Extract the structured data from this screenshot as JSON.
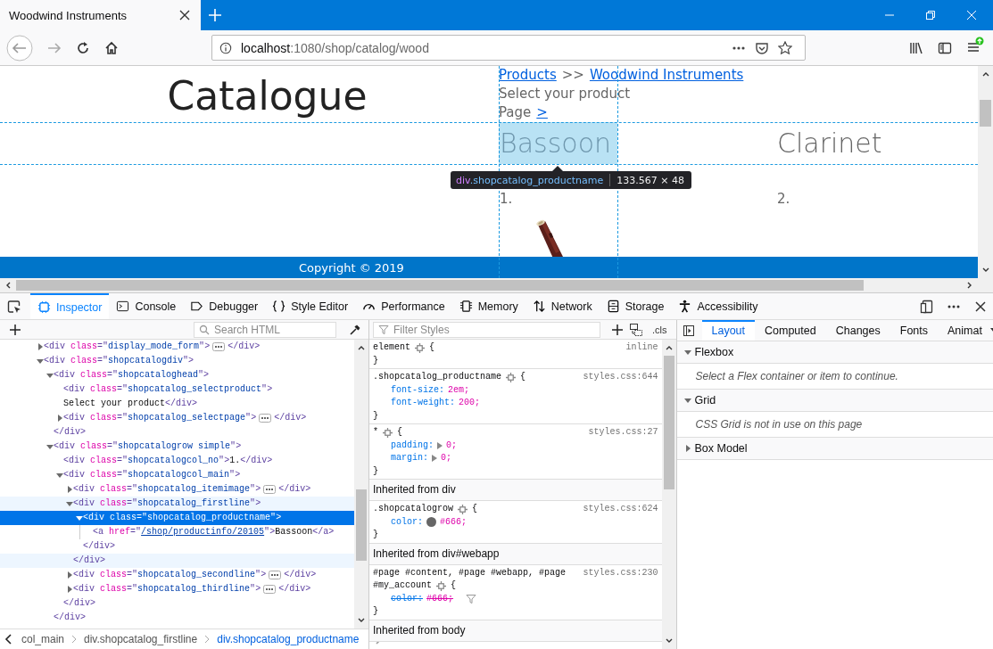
{
  "browser": {
    "tabs": [
      {
        "title": "Woodwind Instruments",
        "selected": true
      }
    ],
    "url_host": "localhost",
    "url_path": ":1080/shop/catalog/wood",
    "update_available": true
  },
  "page": {
    "heading": "Catalogue",
    "breadcrumb": [
      {
        "text": "Products",
        "link": true
      },
      {
        "text": ">>",
        "link": false
      },
      {
        "text": "Woodwind Instruments",
        "link": true
      }
    ],
    "select_label": "Select your product",
    "page_label": "Page",
    "page_link": ">",
    "products": [
      {
        "name": "Bassoon",
        "number": "1.",
        "highlighted": true
      },
      {
        "name": "Clarinet",
        "number": "2.",
        "highlighted": false
      }
    ],
    "footer": "Copyright © 2019"
  },
  "highlighter": {
    "tag": "div",
    "class_name": ".shopcatalog_productname",
    "size": "133.567 × 48"
  },
  "devtools": {
    "tools": [
      {
        "label": "Inspector",
        "kind": "inspector",
        "selected": true
      },
      {
        "label": "Console",
        "kind": "console",
        "selected": false
      },
      {
        "label": "Debugger",
        "kind": "debugger",
        "selected": false
      },
      {
        "label": "Style Editor",
        "kind": "style-editor",
        "selected": false
      },
      {
        "label": "Performance",
        "kind": "performance",
        "selected": false
      },
      {
        "label": "Memory",
        "kind": "memory",
        "selected": false
      },
      {
        "label": "Network",
        "kind": "network",
        "selected": false
      },
      {
        "label": "Storage",
        "kind": "storage",
        "selected": false
      },
      {
        "label": "Accessibility",
        "kind": "accessibility",
        "selected": false
      }
    ],
    "html_search": {
      "placeholder": "Search HTML"
    },
    "tree": [
      {
        "open_tag": "<div class=\"display_mode_form\">",
        "close_tag": "</div>",
        "expanded": false,
        "selected": false,
        "hovered": false
      },
      {
        "open_tag": "<div class=\"shopcatalogdiv\">",
        "expanded": true,
        "selected": false,
        "hovered": false,
        "children": [
          {
            "open_tag": "<div class=\"shopcataloghead\">",
            "close_tag": "</div>",
            "expanded": true,
            "selected": false,
            "hovered": false,
            "children": [
              {
                "open_tag": "<div class=\"shopcatalog_selectproduct\">",
                "text": "Select your product",
                "close_tag": "</div>",
                "selected": false,
                "hovered": false
              },
              {
                "open_tag": "<div class=\"shopcatalog_selectpage\">",
                "close_tag": "</div>",
                "expanded": false,
                "selected": false,
                "hovered": false
              }
            ]
          },
          {
            "open_tag": "<div class=\"shopcatalogrow simple\">",
            "close_tag": "</div>",
            "expanded": true,
            "selected": false,
            "hovered": false,
            "children": [
              {
                "open_tag": "<div class=\"shopcatalogcol_no\">",
                "text": "1.",
                "close_tag": "</div>",
                "selected": false,
                "hovered": false
              },
              {
                "open_tag": "<div class=\"shopcatalogcol_main\">",
                "close_tag": "</div>",
                "expanded": true,
                "selected": false,
                "hovered": false,
                "children": [
                  {
                    "open_tag": "<div class=\"shopcatalog_itemimage\">",
                    "close_tag": "</div>",
                    "expanded": false,
                    "selected": false,
                    "hovered": false
                  },
                  {
                    "open_tag": "<div class=\"shopcatalog_firstline\">",
                    "close_tag": "</div>",
                    "expanded": true,
                    "selected": false,
                    "hovered": true,
                    "children": [
                      {
                        "open_tag": "<div class=\"shopcatalog_productname\">",
                        "close_tag": "</div>",
                        "expanded": true,
                        "selected": true,
                        "hovered": false,
                        "children": [
                          {
                            "open_tag": "<a href=\"/shop/productinfo/20105\">",
                            "text": "Bassoon",
                            "close_tag": "</a>",
                            "link_values": true,
                            "selected": false,
                            "hovered": false
                          }
                        ]
                      }
                    ]
                  },
                  {
                    "open_tag": "<div class=\"shopcatalog_secondline\">",
                    "close_tag": "</div>",
                    "expanded": false,
                    "selected": false,
                    "hovered": false
                  },
                  {
                    "open_tag": "<div class=\"shopcatalog_thirdline\">",
                    "close_tag": "</div>",
                    "expanded": false,
                    "selected": false,
                    "hovered": false
                  }
                ]
              }
            ]
          }
        ]
      }
    ],
    "breadcrumbs": [
      {
        "label": "col_main",
        "selected": false
      },
      {
        "label": "div.shopcatalog_firstline",
        "selected": false
      },
      {
        "label": "div.shopcatalog_productname",
        "selected": true
      }
    ],
    "styles_filter": {
      "placeholder": "Filter Styles"
    },
    "cls_label": ".cls",
    "rules": [
      {
        "kind": "rule",
        "selector": [
          "element"
        ],
        "open_brace": "{",
        "close_brace": "}",
        "source": "inline"
      },
      {
        "kind": "rule",
        "selector": [
          ".shopcatalog_productname"
        ],
        "open_brace": "{",
        "close_brace": "}",
        "source": "styles.css:644",
        "declarations": [
          {
            "text": "font-size: 2em;",
            "expandable": false,
            "swatch": false,
            "overridden": false
          },
          {
            "text": "font-weight: 200;",
            "expandable": false,
            "swatch": false,
            "overridden": false
          }
        ]
      },
      {
        "kind": "rule",
        "selector": [
          "*"
        ],
        "open_brace": "{",
        "close_brace": "}",
        "source": "styles.css:27",
        "declarations": [
          {
            "text": "padding: 0;",
            "expandable": true,
            "swatch": false,
            "overridden": false
          },
          {
            "text": "margin: 0;",
            "expandable": true,
            "swatch": false,
            "overridden": false
          }
        ]
      },
      {
        "kind": "header",
        "text": "Inherited from div"
      },
      {
        "kind": "rule",
        "selector": [
          ".shopcatalogrow"
        ],
        "open_brace": "{",
        "close_brace": "}",
        "source": "styles.css:624",
        "declarations": [
          {
            "text": "color: #666;",
            "expandable": false,
            "swatch": true,
            "overridden": false
          }
        ]
      },
      {
        "kind": "header",
        "text": "Inherited from div#webapp"
      },
      {
        "kind": "rule",
        "selector": [
          "#page #content, #page #webapp, #page",
          "#my_account"
        ],
        "open_brace": "{",
        "close_brace": "}",
        "source": "styles.css:230",
        "declarations": [
          {
            "text": "color: #666;",
            "expandable": false,
            "swatch": false,
            "overridden": true
          }
        ]
      },
      {
        "kind": "header",
        "text": "Inherited from body"
      }
    ],
    "sidebar_tabs": [
      {
        "label": "Layout",
        "selected": true
      },
      {
        "label": "Computed",
        "selected": false
      },
      {
        "label": "Changes",
        "selected": false
      },
      {
        "label": "Fonts",
        "selected": false
      },
      {
        "label": "Animat",
        "selected": false
      }
    ],
    "sections": [
      {
        "title": "Flexbox",
        "expanded": true,
        "message": "Select a Flex container or item to continue."
      },
      {
        "title": "Grid",
        "expanded": true,
        "message": "CSS Grid is not in use on this page"
      },
      {
        "title": "Box Model",
        "expanded": false
      }
    ]
  }
}
